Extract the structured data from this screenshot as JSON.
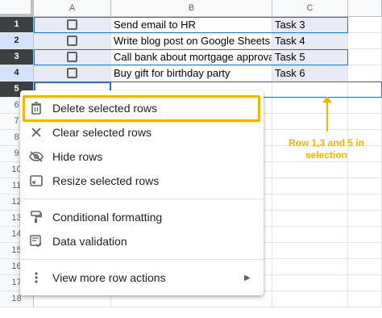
{
  "columns": [
    "A",
    "B",
    "C"
  ],
  "rows": [
    {
      "num": "1",
      "task_text": "Send email to HR",
      "task_id": "Task 3"
    },
    {
      "num": "2",
      "task_text": "Write blog post on Google Sheets",
      "task_id": "Task 4"
    },
    {
      "num": "3",
      "task_text": "Call bank about mortgage approval",
      "task_id": "Task 5"
    },
    {
      "num": "4",
      "task_text": "Buy gift for birthday party",
      "task_id": "Task 6"
    },
    {
      "num": "5",
      "task_text": "",
      "task_id": ""
    },
    {
      "num": "6"
    },
    {
      "num": "7"
    },
    {
      "num": "8"
    },
    {
      "num": "9"
    },
    {
      "num": "10"
    },
    {
      "num": "11"
    },
    {
      "num": "12"
    },
    {
      "num": "13"
    },
    {
      "num": "14"
    },
    {
      "num": "15"
    },
    {
      "num": "16"
    },
    {
      "num": "17"
    },
    {
      "num": "18"
    }
  ],
  "menu": {
    "items": [
      {
        "label": "Delete selected rows",
        "icon": "trash-icon"
      },
      {
        "label": "Clear selected rows",
        "icon": "close-icon"
      },
      {
        "label": "Hide rows",
        "icon": "eye-off-icon"
      },
      {
        "label": "Resize selected rows",
        "icon": "resize-icon"
      },
      {
        "label": "Conditional formatting",
        "icon": "paint-roller-icon"
      },
      {
        "label": "Data validation",
        "icon": "data-validation-icon"
      },
      {
        "label": "View more row actions",
        "icon": "more-vert-icon"
      }
    ]
  },
  "annotation": {
    "text": "Row 1,3 and 5 in selection"
  },
  "colors": {
    "accent": "#1a73e8",
    "annotation": "#f4b400",
    "selected_row_header": "#3c4043"
  }
}
